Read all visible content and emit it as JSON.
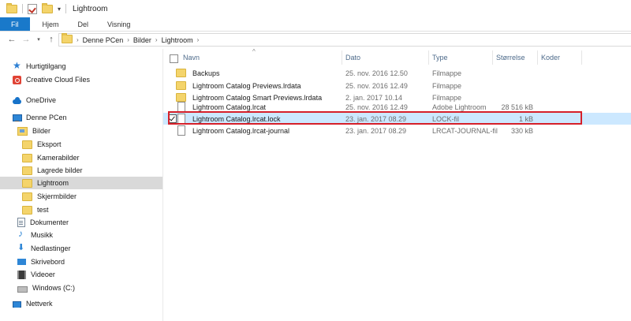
{
  "window": {
    "title": "Lightroom"
  },
  "ribbon": {
    "tabs": [
      "Fil",
      "Hjem",
      "Del",
      "Visning"
    ]
  },
  "address": {
    "crumbs": [
      "Denne PCen",
      "Bilder",
      "Lightroom"
    ]
  },
  "nav": {
    "quick_access": "Hurtigtilgang",
    "creative_cloud": "Creative Cloud Files",
    "onedrive": "OneDrive",
    "this_pc": "Denne PCen",
    "pictures": "Bilder",
    "subfolders": [
      "Eksport",
      "Kamerabilder",
      "Lagrede bilder",
      "Lightroom",
      "Skjermbilder",
      "test"
    ],
    "documents": "Dokumenter",
    "music": "Musikk",
    "downloads": "Nedlastinger",
    "desktop": "Skrivebord",
    "videos": "Videoer",
    "drive": "Windows (C:)",
    "network": "Nettverk"
  },
  "columns": {
    "name": "Navn",
    "date": "Dato",
    "type": "Type",
    "size": "Størrelse",
    "tags": "Koder"
  },
  "files": [
    {
      "name": "Backups",
      "date": "25. nov. 2016 12.50",
      "type": "Filmappe",
      "size": "",
      "kind": "folder"
    },
    {
      "name": "Lightroom Catalog Previews.lrdata",
      "date": "25. nov. 2016 12.49",
      "type": "Filmappe",
      "size": "",
      "kind": "folder"
    },
    {
      "name": "Lightroom Catalog Smart Previews.lrdata",
      "date": "2. jan. 2017 10.14",
      "type": "Filmappe",
      "size": "",
      "kind": "folder"
    },
    {
      "name": "Lightroom Catalog.lrcat",
      "date": "25. nov. 2016 12.49",
      "type": "Adobe Lightroom",
      "size": "28 516 kB",
      "kind": "file"
    },
    {
      "name": "Lightroom Catalog.lrcat.lock",
      "date": "23. jan. 2017 08.29",
      "type": "LOCK-fil",
      "size": "1 kB",
      "kind": "file",
      "selected": true
    },
    {
      "name": "Lightroom Catalog.lrcat-journal",
      "date": "23. jan. 2017 08.29",
      "type": "LRCAT-JOURNAL-fil",
      "size": "330 kB",
      "kind": "file"
    }
  ]
}
